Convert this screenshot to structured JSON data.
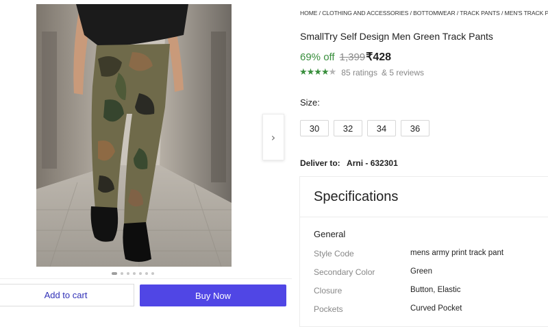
{
  "gallery": {
    "next_icon": "chevron-right-icon",
    "dot_count": 7,
    "active_dot": 0
  },
  "actions": {
    "add_to_cart": "Add to cart",
    "buy_now": "Buy Now"
  },
  "breadcrumb": "HOME / CLOTHING AND ACCESSORIES / BOTTOMWEAR / TRACK PANTS / MEN'S TRACK PANTS",
  "product": {
    "title": "SmallTry Self Design Men Green Track Pants",
    "discount": "69% off",
    "mrp": "1,399",
    "price": "₹428",
    "rating_value": 4.5,
    "ratings": "85 ratings",
    "reviews": "& 5 reviews"
  },
  "size": {
    "label": "Size:",
    "options": [
      "30",
      "32",
      "34",
      "36"
    ]
  },
  "delivery": {
    "label": "Deliver to:",
    "location": "Arni - 632301"
  },
  "specifications": {
    "title": "Specifications",
    "group": "General",
    "rows": [
      {
        "key": "Style Code",
        "value": "mens army print track pant"
      },
      {
        "key": "Secondary Color",
        "value": "Green"
      },
      {
        "key": "Closure",
        "value": "Button, Elastic"
      },
      {
        "key": "Pockets",
        "value": "Curved Pocket"
      }
    ]
  },
  "colors": {
    "accent": "#5046e5",
    "discount_green": "#388e3c",
    "star_green": "#388e3c"
  }
}
